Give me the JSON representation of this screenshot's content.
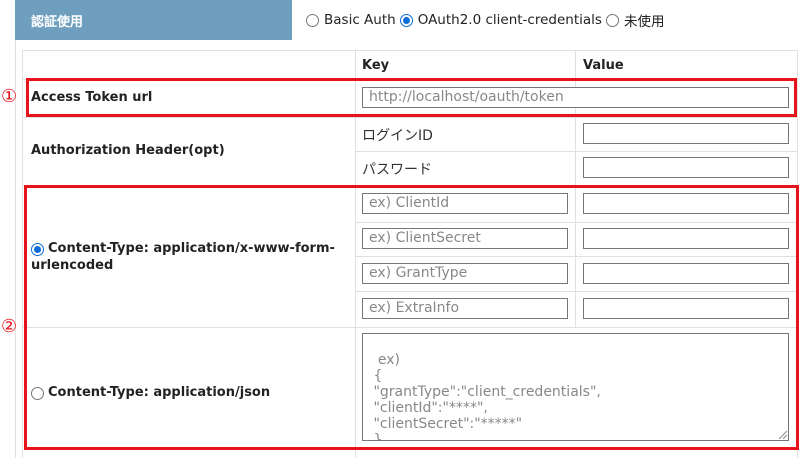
{
  "auth": {
    "header_label": "認証使用",
    "options": [
      {
        "label": "Basic Auth",
        "checked": false
      },
      {
        "label": "OAuth2.0 client-credentials",
        "checked": true
      },
      {
        "label": "未使用",
        "checked": false
      }
    ]
  },
  "table": {
    "headers": {
      "key": "Key",
      "value": "Value"
    },
    "access_token": {
      "label": "Access Token url",
      "placeholder": "http://localhost/oauth/token"
    },
    "authorization_header": {
      "label": "Authorization Header(opt)",
      "rows": [
        {
          "key": "ログインID",
          "value": ""
        },
        {
          "key": "パスワード",
          "value": ""
        }
      ]
    },
    "form_urlencoded": {
      "label": "Content-Type: application/x-www-form-urlencoded",
      "label_line1": "Content-Type: application/x-www-form-",
      "label_line2": "urlencoded",
      "checked": true,
      "rows": [
        {
          "key_placeholder": "ex) ClientId",
          "value": ""
        },
        {
          "key_placeholder": "ex) ClientSecret",
          "value": ""
        },
        {
          "key_placeholder": "ex) GrantType",
          "value": ""
        },
        {
          "key_placeholder": "ex) ExtraInfo",
          "value": ""
        }
      ]
    },
    "json": {
      "label": "Content-Type: application/json",
      "checked": false,
      "placeholder": "ex)\n {\n \"grantType\":\"client_credentials\",\n \"clientId\":\"****\",\n \"clientSecret\":\"*****\"\n }"
    }
  },
  "annotations": {
    "marker_1": "①",
    "marker_2": "②",
    "highlight_color": "#e8121b"
  },
  "colors": {
    "header_bg": "#6f9fbf",
    "radio_selected": "#0a6cd5"
  }
}
